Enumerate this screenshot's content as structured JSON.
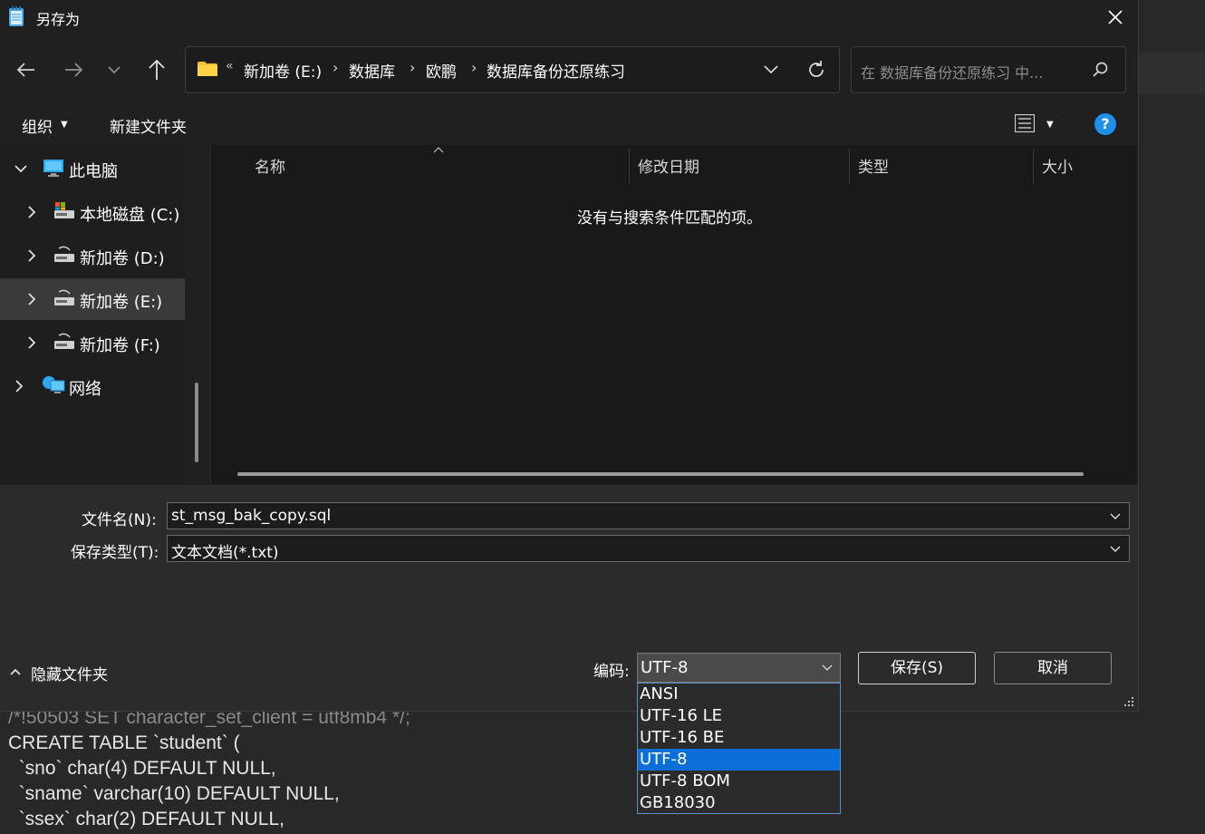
{
  "window": {
    "title": "另存为"
  },
  "address": {
    "overflow": "«",
    "crumbs": [
      "新加卷 (E:)",
      "数据库",
      "欧鹏",
      "数据库备份还原练习"
    ],
    "search_placeholder": "在 数据库备份还原练习 中..."
  },
  "toolbar": {
    "organize": "组织",
    "new_folder": "新建文件夹"
  },
  "nav": {
    "items": [
      {
        "label": "此电脑",
        "icon": "computer-icon",
        "expanded": true
      },
      {
        "label": "本地磁盘 (C:)",
        "icon": "system-drive-icon"
      },
      {
        "label": "新加卷 (D:)",
        "icon": "drive-icon"
      },
      {
        "label": "新加卷 (E:)",
        "icon": "drive-icon",
        "selected": true
      },
      {
        "label": "新加卷 (F:)",
        "icon": "drive-icon"
      },
      {
        "label": "网络",
        "icon": "network-icon"
      }
    ]
  },
  "files": {
    "columns": [
      "名称",
      "修改日期",
      "类型",
      "大小"
    ],
    "empty_message": "没有与搜索条件匹配的项。"
  },
  "form": {
    "filename_label": "文件名(N):",
    "filename_value": "st_msg_bak_copy.sql",
    "filetype_label": "保存类型(T):",
    "filetype_value": "文本文档(*.txt)",
    "encoding_label": "编码:",
    "encoding_value": "UTF-8",
    "hide_folders": "隐藏文件夹",
    "save_button": "保存(S)",
    "cancel_button": "取消"
  },
  "encoding_options": [
    "ANSI",
    "UTF-16 LE",
    "UTF-16 BE",
    "UTF-8",
    "UTF-8 BOM",
    "GB18030"
  ],
  "encoding_selected": "UTF-8",
  "background_code": [
    "/*!50503 SET character_set_client = utf8mb4 */;",
    "CREATE TABLE `student` (",
    "  `sno` char(4) DEFAULT NULL,",
    "  `sname` varchar(10) DEFAULT NULL,",
    "  `ssex` char(2) DEFAULT NULL,"
  ],
  "colors": {
    "accent": "#0a6fd8",
    "help": "#1e90e8",
    "dialog_bg": "#202020"
  }
}
